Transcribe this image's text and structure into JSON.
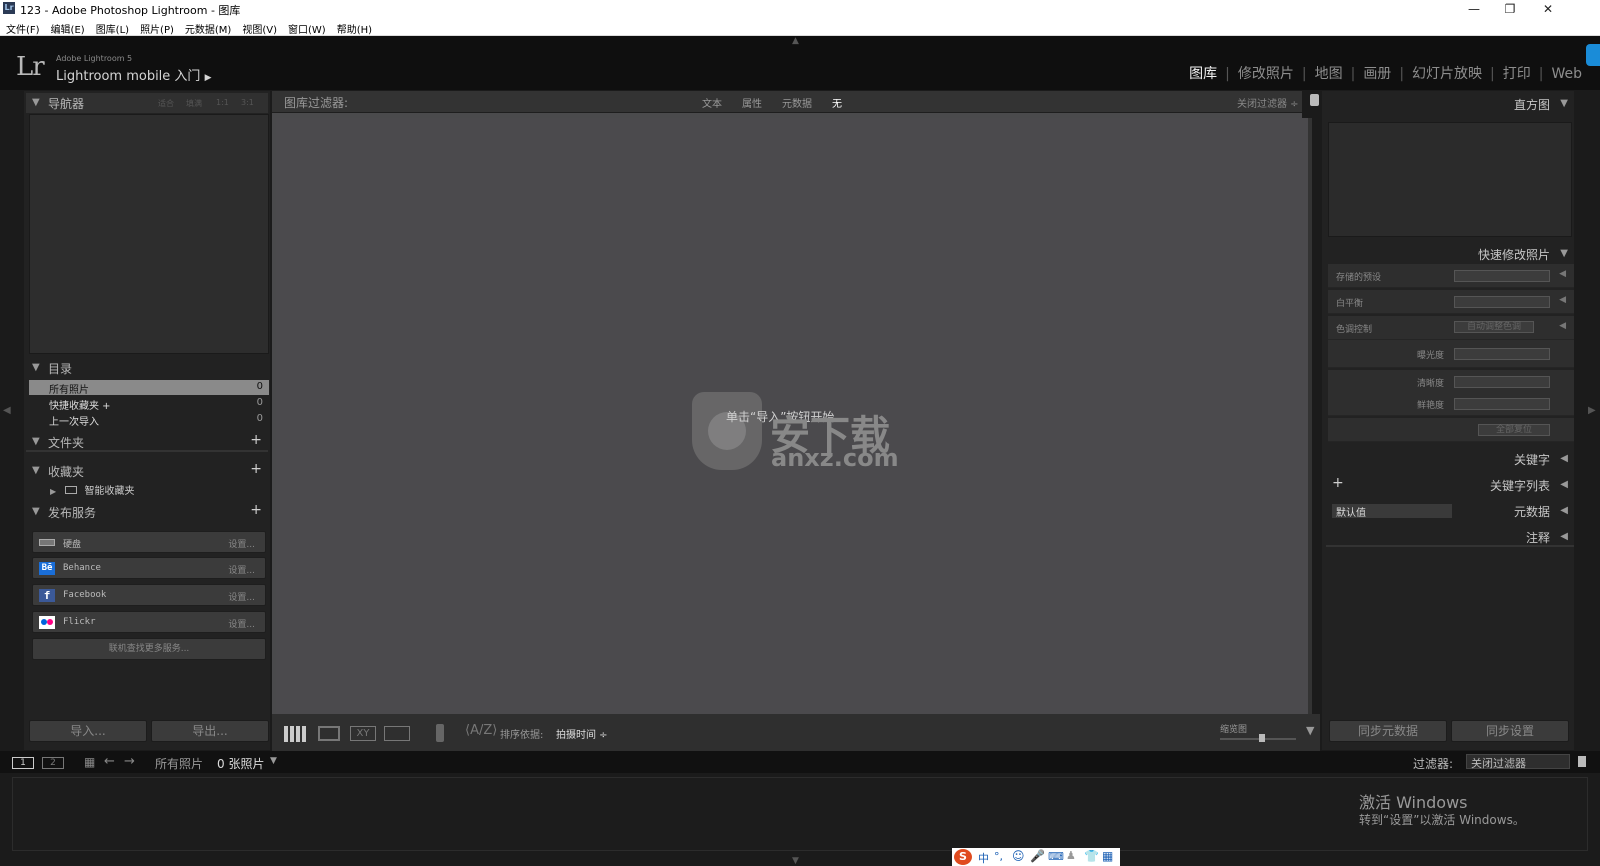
{
  "window": {
    "title": "123 - Adobe Photoshop Lightroom - 图库",
    "app_icon": "Lr",
    "minimize": "—",
    "maximize": "❐",
    "close": "✕"
  },
  "menu": [
    "文件(F)",
    "编辑(E)",
    "图库(L)",
    "照片(P)",
    "元数据(M)",
    "视图(V)",
    "窗口(W)",
    "帮助(H)"
  ],
  "header": {
    "logo": "Lr",
    "product": "Adobe Lightroom 5",
    "identity": "Lightroom mobile 入门",
    "modules": [
      "图库",
      "修改照片",
      "地图",
      "画册",
      "幻灯片放映",
      "打印",
      "Web"
    ],
    "active_module": "图库"
  },
  "left": {
    "navigator": {
      "title": "导航器",
      "zoom_options": [
        "适合",
        "填满",
        "1:1",
        "3:1"
      ]
    },
    "catalog": {
      "title": "目录",
      "items": [
        {
          "label": "所有照片",
          "count": "0"
        },
        {
          "label": "快捷收藏夹 +",
          "count": "0"
        },
        {
          "label": "上一次导入",
          "count": "0"
        }
      ]
    },
    "folders": {
      "title": "文件夹"
    },
    "collections": {
      "title": "收藏夹",
      "smart": "智能收藏夹"
    },
    "publish": {
      "title": "发布服务",
      "services": [
        {
          "name": "硬盘",
          "action": "设置..."
        },
        {
          "name": "Behance",
          "action": "设置..."
        },
        {
          "name": "Facebook",
          "action": "设置..."
        },
        {
          "name": "Flickr",
          "action": "设置..."
        }
      ],
      "more": "联机查找更多服务..."
    },
    "import": "导入...",
    "export": "导出..."
  },
  "filter": {
    "label": "图库过滤器:",
    "options": [
      "文本",
      "属性",
      "元数据",
      "无"
    ],
    "active": "无",
    "close": "关闭过滤器 ÷"
  },
  "center": {
    "hint": "单击“导入”按钮开始。",
    "watermark_cn": "安下载",
    "watermark_en": "anxz.com"
  },
  "toolbar": {
    "sort_label": "排序依据:",
    "sort_value": "拍摄时间 ÷",
    "thumb_label": "缩览图",
    "thumb_size": 0.55
  },
  "right": {
    "histogram": "直方图",
    "quick_develop": {
      "title": "快速修改照片",
      "saved_preset": "存储的预设",
      "white_balance": "白平衡",
      "tone_control": "色调控制",
      "auto_tone": "自动调整色调",
      "exposure": "曝光度",
      "clarity": "清晰度",
      "vibrance": "鲜艳度",
      "reset": "全部复位"
    },
    "keywording": "关键字",
    "keyword_list": "关键字列表",
    "metadata": "元数据",
    "metadata_preset": "默认值",
    "comments": "注释",
    "sync_metadata": "同步元数据",
    "sync_settings": "同步设置"
  },
  "filmstrip": {
    "page1": "1",
    "page2": "2",
    "source": "所有照片",
    "count": "0 张照片",
    "filter_label": "过滤器:",
    "filter_value": "关闭过滤器"
  },
  "activation": {
    "line1": "激活 Windows",
    "line2": "转到“设置”以激活 Windows。"
  },
  "ime": {
    "chinese": "中"
  },
  "colors": {
    "accent": "#1a8cd8",
    "bg": "#1b1b1b",
    "center": "#4a4a4c",
    "ime": "#e04b1f"
  }
}
